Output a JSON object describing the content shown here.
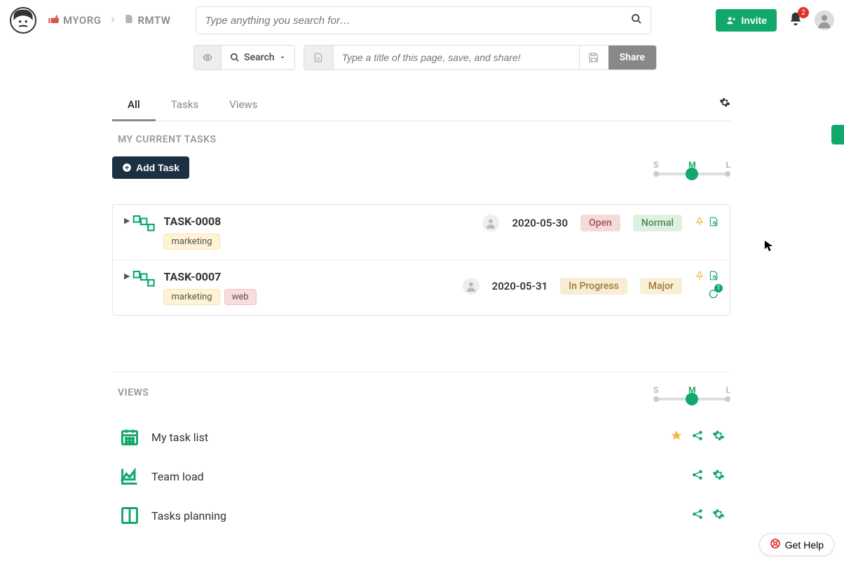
{
  "header": {
    "breadcrumb": {
      "org": "MYORG",
      "project": "RMTW"
    },
    "search_placeholder": "Type anything you search for…",
    "invite_label": "Invite",
    "notification_count": "2"
  },
  "toolbar": {
    "search_label": "Search",
    "title_placeholder": "Type a title of this page, save, and share!",
    "share_label": "Share"
  },
  "tabs": [
    "All",
    "Tasks",
    "Views"
  ],
  "sections": {
    "tasks_title": "MY CURRENT TASKS",
    "add_task_label": "Add Task",
    "views_title": "VIEWS"
  },
  "size_slider": {
    "labels": [
      "S",
      "M",
      "L"
    ],
    "active": "M"
  },
  "tasks": [
    {
      "id": "TASK-0008",
      "tags": [
        "marketing"
      ],
      "date": "2020-05-30",
      "status": "Open",
      "status_class": "open",
      "priority": "Normal",
      "priority_class": "normal",
      "comments": 0
    },
    {
      "id": "TASK-0007",
      "tags": [
        "marketing",
        "web"
      ],
      "date": "2020-05-31",
      "status": "In Progress",
      "status_class": "inprogress",
      "priority": "Major",
      "priority_class": "major",
      "comments": 1
    }
  ],
  "views": [
    {
      "name": "My task list",
      "icon": "calendar",
      "starred": true
    },
    {
      "name": "Team load",
      "icon": "area",
      "starred": false
    },
    {
      "name": "Tasks planning",
      "icon": "board",
      "starred": false
    }
  ],
  "help_label": "Get Help"
}
